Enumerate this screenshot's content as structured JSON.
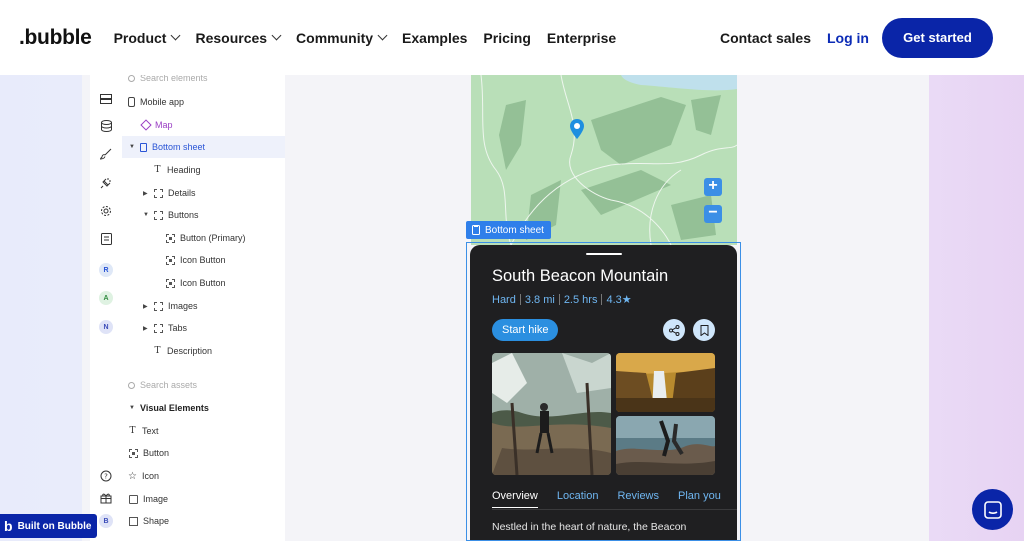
{
  "nav": {
    "logo": ".bubble",
    "menu": [
      "Product",
      "Resources",
      "Community",
      "Examples",
      "Pricing",
      "Enterprise"
    ],
    "contact_sales": "Contact sales",
    "log_in": "Log in",
    "get_started": "Get started"
  },
  "editor": {
    "rail_badges": [
      "R",
      "A",
      "N",
      "B"
    ],
    "elements_search_placeholder": "Search elements",
    "tree": [
      {
        "label": "Mobile app"
      },
      {
        "label": "Map"
      },
      {
        "label": "Bottom sheet"
      },
      {
        "label": "Heading"
      },
      {
        "label": "Details"
      },
      {
        "label": "Buttons"
      },
      {
        "label": "Button (Primary)"
      },
      {
        "label": "Icon Button"
      },
      {
        "label": "Icon Button"
      },
      {
        "label": "Images"
      },
      {
        "label": "Tabs"
      },
      {
        "label": "Description"
      }
    ],
    "assets_search_placeholder": "Search assets",
    "visual_elements_title": "Visual Elements",
    "assets": [
      "Text",
      "Button",
      "Icon",
      "Image",
      "Shape"
    ]
  },
  "canvas": {
    "selection_label": "Bottom sheet",
    "zoom_in": "+",
    "zoom_out": "−",
    "trail": {
      "title": "South Beacon Mountain",
      "difficulty": "Hard",
      "distance": "3.8 mi",
      "duration": "2.5 hrs",
      "rating": "4.3★",
      "start_button": "Start hike",
      "tabs": [
        "Overview",
        "Location",
        "Reviews",
        "Plan you"
      ],
      "description": "Nestled in the heart of nature, the Beacon"
    }
  },
  "footer": {
    "built_on": "Built on Bubble"
  },
  "colors": {
    "brand_blue": "#0a25a8",
    "accent_blue": "#2f7fea",
    "map_green": "#b9dfb8",
    "sheet_dark": "#1f1f21"
  }
}
